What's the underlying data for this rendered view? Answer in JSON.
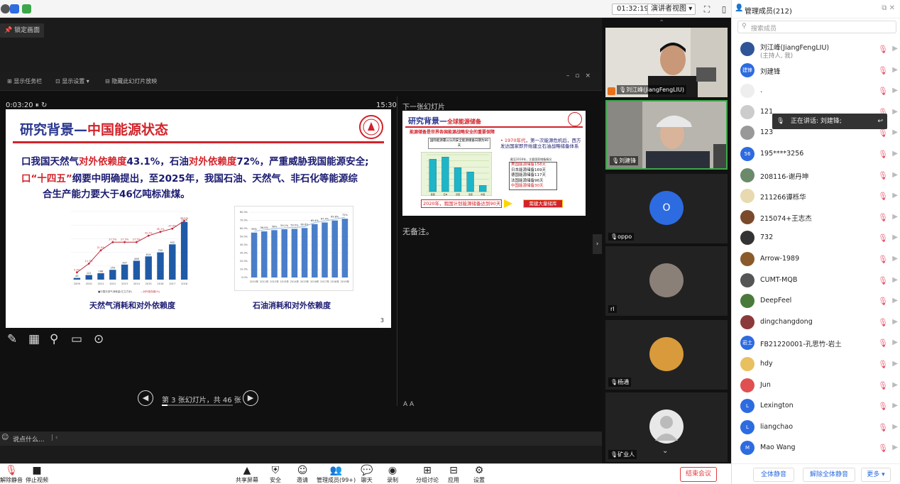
{
  "topbar": {
    "clock": "01:32:19",
    "view_mode": "演讲者视图"
  },
  "main": {
    "lock_label": "锁定画面",
    "ppt_toolbar": {
      "tool1": "显示任务栏",
      "tool2": "显示设置 ▾",
      "tool3": "隐藏此幻灯片放映"
    },
    "timer": "0:03:20",
    "elapsed": "15:30",
    "next_slide_label": "下一张幻灯片",
    "no_notes": "无备注。",
    "nav_text": "第 3 张幻灯片，共 46 张",
    "font_ctrl": "A  A",
    "chat_placeholder": "说点什么..."
  },
  "slide": {
    "title_part1": "研究背景—",
    "title_part2": "中国能源状态",
    "bullet1_a": "口我国天然气",
    "bullet1_b": "对外依赖度",
    "bullet1_c": "43.1%，石油",
    "bullet1_d": "对外依赖度",
    "bullet1_e": "72%，严重威胁我国能源安全;",
    "bullet2_a": "口“十四五”",
    "bullet2_b": "纲要中明确提出，至2025年，我国石油、天然气、非石化等能源综",
    "bullet2_c": "合生产能力要大于46亿吨标准煤。",
    "chart1_caption": "天然气消耗和对外依赖度",
    "chart2_caption": "石油消耗和对外依赖度",
    "page_num": "3"
  },
  "next_slide": {
    "title_part1": "研究背景—",
    "title_part2": "全球能源储备",
    "subtitle": "能源储备是世界各国能源战略安全的重要保障",
    "box_label": "国际能源署公认的安全能源储备日期为90天",
    "text1_a": "1970年代",
    "text1_b": "，第一次能源危机后，西方发达国家即开始建立石油战略储备体系",
    "note": "截至2016年，主要国家储备情况",
    "list": [
      "美国能源储备158天",
      "日本能源储备169天",
      "德国能源储备117天",
      "法国能源储备96天",
      "中国能源储备30天"
    ],
    "footer_text": "2020年，我国计划能源储备达到90天",
    "footer_box": "需建大量储库"
  },
  "chart_data": [
    {
      "type": "bar",
      "title": "天然气消耗和对外依赖度",
      "categories": [
        "2009",
        "2010",
        "2011",
        "2012",
        "2013",
        "2014",
        "2015",
        "2016",
        "2017",
        "2018"
      ],
      "series": [
        {
          "name": "中国天然气消耗量(亿立方米)",
          "values": [
            45,
            121,
            168,
            259,
            397,
            498,
            614,
            720,
            932,
            1526
          ]
        },
        {
          "name": "对外依存度(%)",
          "type": "line",
          "values": [
            5.3,
            11.7,
            21.5,
            27.5,
            27.5,
            27.5,
            32.2,
            35.1,
            37.4,
            43.1
          ]
        }
      ]
    },
    {
      "type": "bar",
      "title": "石油消耗和对外依赖度",
      "categories": [
        "2010年",
        "2011年",
        "2012年",
        "2013年",
        "2014年",
        "2015年",
        "2016年",
        "2017年",
        "2018年",
        "2019年"
      ],
      "series": [
        {
          "name": "石油对外依存度(%)",
          "values": [
            55,
            56.5,
            58,
            59.1,
            59.5,
            60.6,
            65.4,
            67.4,
            69.8,
            72
          ]
        }
      ],
      "ylim": [
        0,
        80
      ]
    },
    {
      "type": "bar",
      "title": "",
      "categories": [
        "美国",
        "日本",
        "德国",
        "法国",
        "中国"
      ],
      "series": [
        {
          "name": "储备天数",
          "values": [
            158,
            169,
            117,
            96,
            30
          ]
        }
      ]
    }
  ],
  "video": {
    "tiles": [
      {
        "name": "刘江峰(JiangFengLIU)"
      },
      {
        "name": "刘建锋"
      },
      {
        "name": "oppo",
        "avatar_text": "O"
      },
      {
        "name": "rl"
      },
      {
        "name": "杨通"
      },
      {
        "name": "矿业人"
      }
    ],
    "speaking": "正在讲话: 刘建锋;"
  },
  "panel": {
    "title": "管理成员(212)",
    "search_placeholder": "搜索成员",
    "members": [
      {
        "name": "刘江峰(JiangFengLIU)",
        "role": "(主持人, 我)",
        "color": "#2f5597"
      },
      {
        "name": "刘建锋",
        "avatar": "建锋",
        "color": "#2d6be0"
      },
      {
        "name": ".",
        "color": "#eeeeee"
      },
      {
        "name": "121",
        "color": "#cccccc"
      },
      {
        "name": "123",
        "color": "#999999"
      },
      {
        "name": "195****3256",
        "avatar": "56",
        "color": "#2d6be0"
      },
      {
        "name": "208116-谢丹坤",
        "color": "#6a8a6a"
      },
      {
        "name": "211266谭栎华",
        "color": "#e8d9b0"
      },
      {
        "name": "215074+王志杰",
        "color": "#7a4a2a"
      },
      {
        "name": "732",
        "color": "#333333"
      },
      {
        "name": "Arrow-1989",
        "color": "#8a5a2a"
      },
      {
        "name": "CUMT-MQB",
        "color": "#555555"
      },
      {
        "name": "DeepFeel",
        "color": "#4a7a3a"
      },
      {
        "name": "dingchangdong",
        "color": "#8a3a3a"
      },
      {
        "name": "FB21220001-孔思竹-岩土",
        "avatar": "岩土",
        "color": "#2d6be0"
      },
      {
        "name": "hdy",
        "color": "#e8c060"
      },
      {
        "name": "Jun",
        "color": "#e05050"
      },
      {
        "name": "Lexington",
        "avatar": "L",
        "color": "#2d6be0"
      },
      {
        "name": "liangchao",
        "avatar": "L",
        "color": "#2d6be0"
      },
      {
        "name": "Mao Wang",
        "avatar": "M",
        "color": "#2d6be0"
      }
    ],
    "footer": {
      "mute_all": "全体静音",
      "unmute_all": "解除全体静音",
      "more": "更多 ▾"
    }
  },
  "bottombar": {
    "items": [
      {
        "label": "解除静音"
      },
      {
        "label": "停止视频"
      },
      {
        "label": "共享屏幕"
      },
      {
        "label": "安全"
      },
      {
        "label": "邀请"
      },
      {
        "label": "管理成员(99+)"
      },
      {
        "label": "聊天"
      },
      {
        "label": "录制"
      },
      {
        "label": "分组讨论"
      },
      {
        "label": "应用"
      },
      {
        "label": "设置"
      }
    ],
    "end_meeting": "结束会议"
  },
  "colors": {
    "accent": "#2d6be0",
    "danger": "#e23a3a",
    "slide_red": "#d2232a",
    "slide_blue": "#2b3990",
    "chart_bar": "#1f5aa6"
  }
}
